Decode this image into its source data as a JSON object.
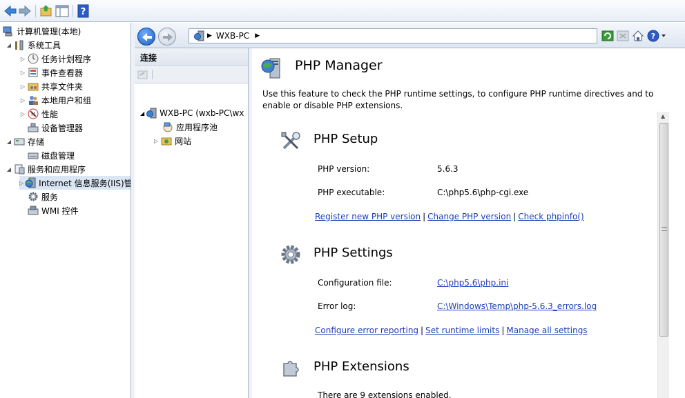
{
  "tree": {
    "root": "计算机管理(本地)",
    "items": [
      {
        "label": "系统工具",
        "level": 1
      },
      {
        "label": "任务计划程序",
        "level": 2
      },
      {
        "label": "事件查看器",
        "level": 2
      },
      {
        "label": "共享文件夹",
        "level": 2
      },
      {
        "label": "本地用户和组",
        "level": 2
      },
      {
        "label": "性能",
        "level": 2
      },
      {
        "label": "设备管理器",
        "level": 2
      },
      {
        "label": "存储",
        "level": 1
      },
      {
        "label": "磁盘管理",
        "level": 2
      },
      {
        "label": "服务和应用程序",
        "level": 1
      },
      {
        "label": "Internet 信息服务(IIS)管",
        "level": 2
      },
      {
        "label": "服务",
        "level": 2
      },
      {
        "label": "WMI 控件",
        "level": 2
      }
    ]
  },
  "address": {
    "server": "WXB-PC"
  },
  "connections": {
    "title": "连接",
    "server_node": "WXB-PC (wxb-PC\\wx",
    "app_pools": "应用程序池",
    "sites": "网站"
  },
  "php_manager": {
    "title": "PHP Manager",
    "description": "Use this feature to check the PHP runtime settings, to configure PHP runtime directives and to enable or disable PHP extensions.",
    "setup": {
      "title": "PHP Setup",
      "version_label": "PHP version:",
      "version_value": "5.6.3",
      "exe_label": "PHP executable:",
      "exe_value": "C:\\php5.6\\php-cgi.exe",
      "link_register": "Register new PHP version",
      "link_change": "Change PHP version",
      "link_phpinfo": "Check phpinfo()"
    },
    "settings": {
      "title": "PHP Settings",
      "config_label": "Configuration file:",
      "config_value": "C:\\php5.6\\php.ini",
      "errorlog_label": "Error log:",
      "errorlog_value": "C:\\Windows\\Temp\\php-5.6.3_errors.log",
      "link_error_reporting": "Configure error reporting",
      "link_runtime": "Set runtime limits",
      "link_manage": "Manage all settings"
    },
    "extensions": {
      "title": "PHP Extensions",
      "summary": "There are 9 extensions enabled."
    }
  },
  "separators": {
    "pipe": "|"
  }
}
